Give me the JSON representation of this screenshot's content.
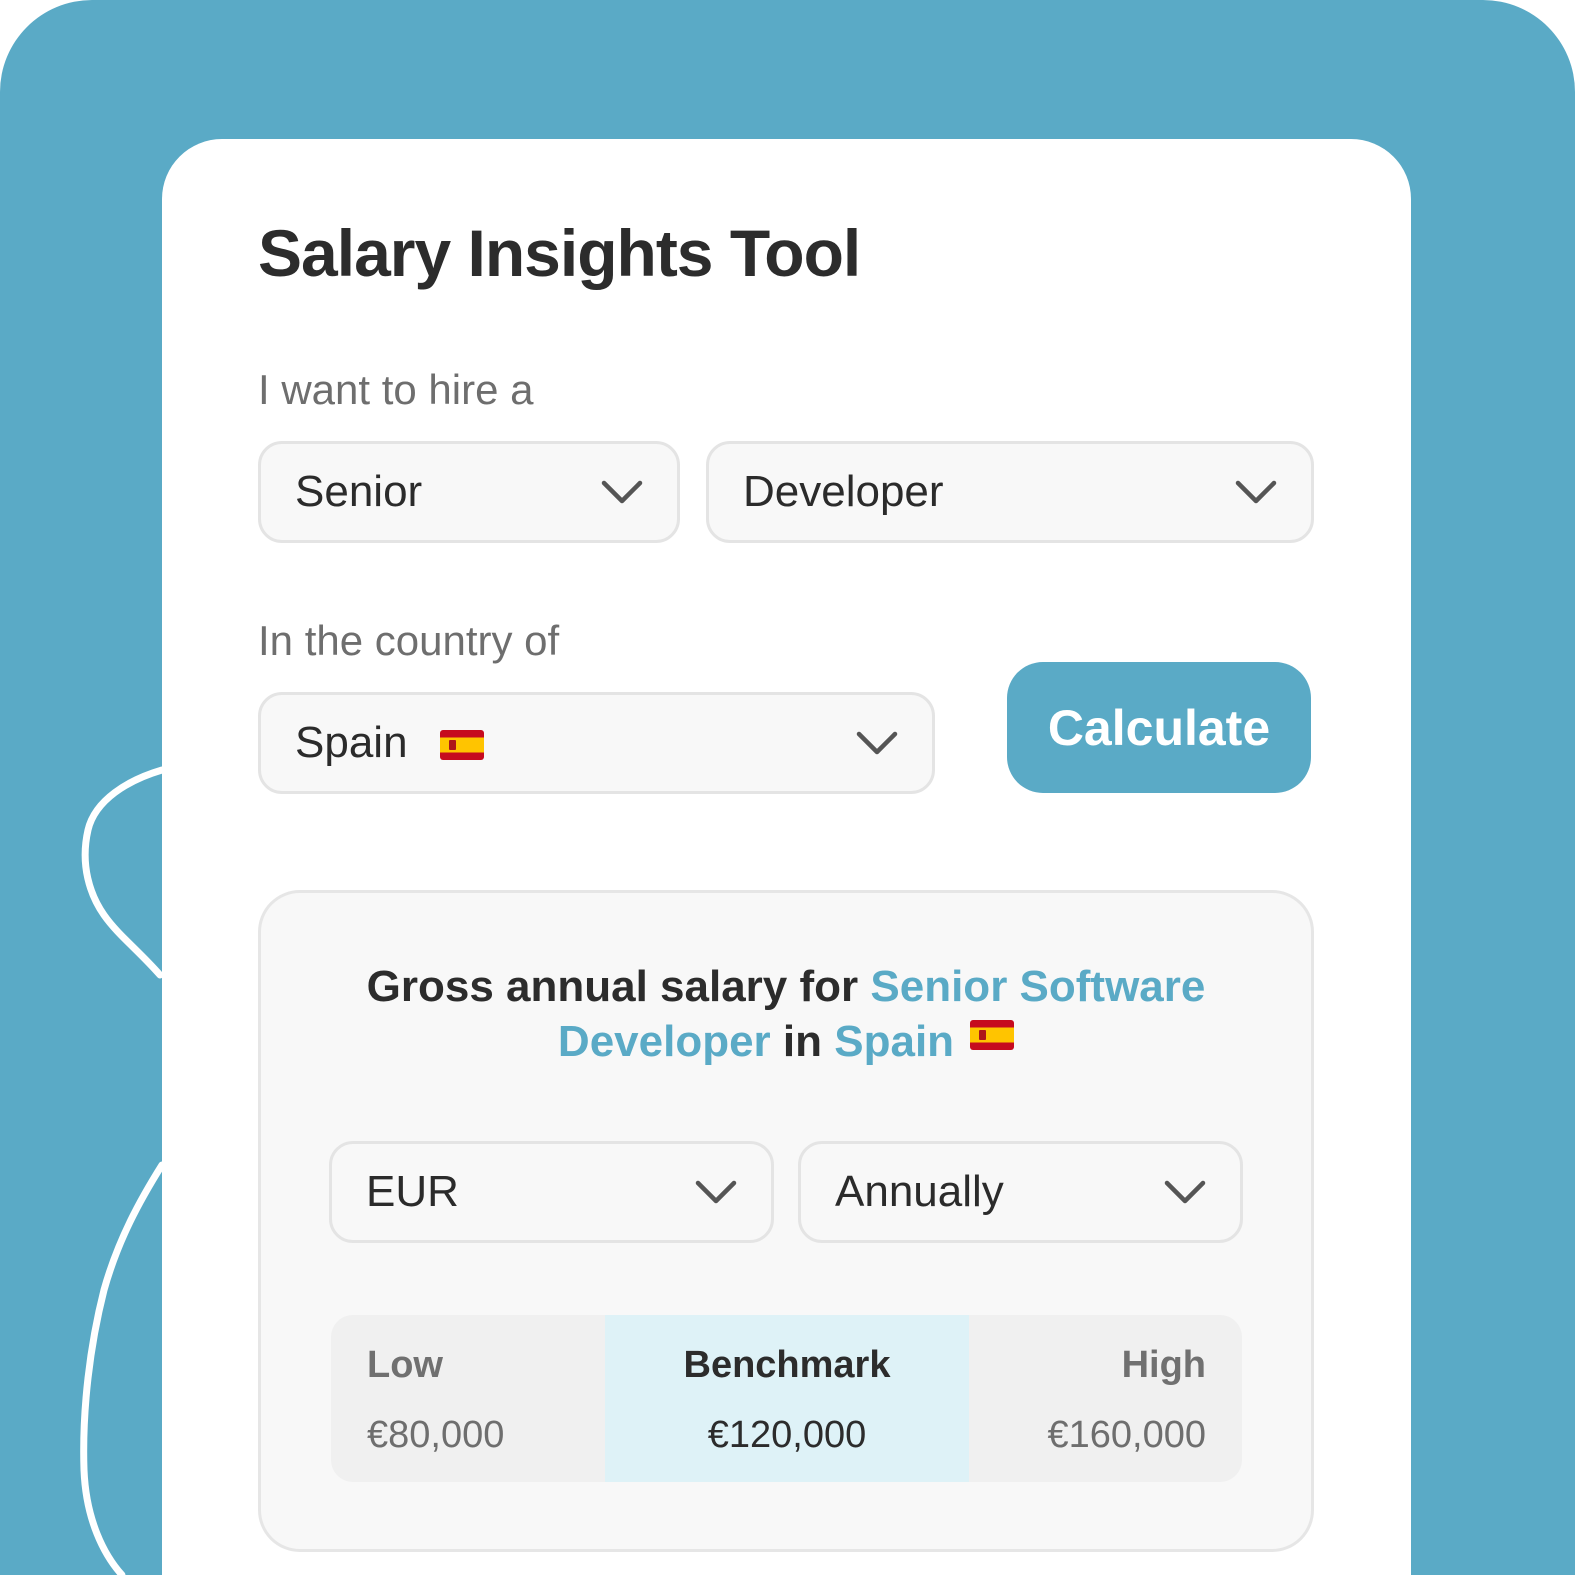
{
  "tool": {
    "title": "Salary Insights Tool"
  },
  "form": {
    "hire_label": "I want to hire a",
    "seniority": {
      "selected": "Senior"
    },
    "role": {
      "selected": "Developer"
    },
    "country_label": "In the country of",
    "country": {
      "selected": "Spain",
      "flag": "spain-flag-icon"
    },
    "calculate_label": "Calculate"
  },
  "results": {
    "heading_prefix": "Gross annual salary for",
    "heading_role": "Senior Software Developer",
    "heading_in": "in",
    "heading_country": "Spain",
    "currency": {
      "selected": "EUR"
    },
    "period": {
      "selected": "Annually"
    },
    "range": {
      "low_label": "Low",
      "low_value": "€80,000",
      "benchmark_label": "Benchmark",
      "benchmark_value": "€120,000",
      "high_label": "High",
      "high_value": "€160,000"
    }
  },
  "colors": {
    "brand": "#5aaac6",
    "benchmark_bg": "#def2f7",
    "text_dark": "#2c2c2c",
    "text_muted": "#6e6e6e"
  },
  "icons": {
    "dropdown": "chevron-down-icon",
    "country": "spain-flag-icon"
  }
}
